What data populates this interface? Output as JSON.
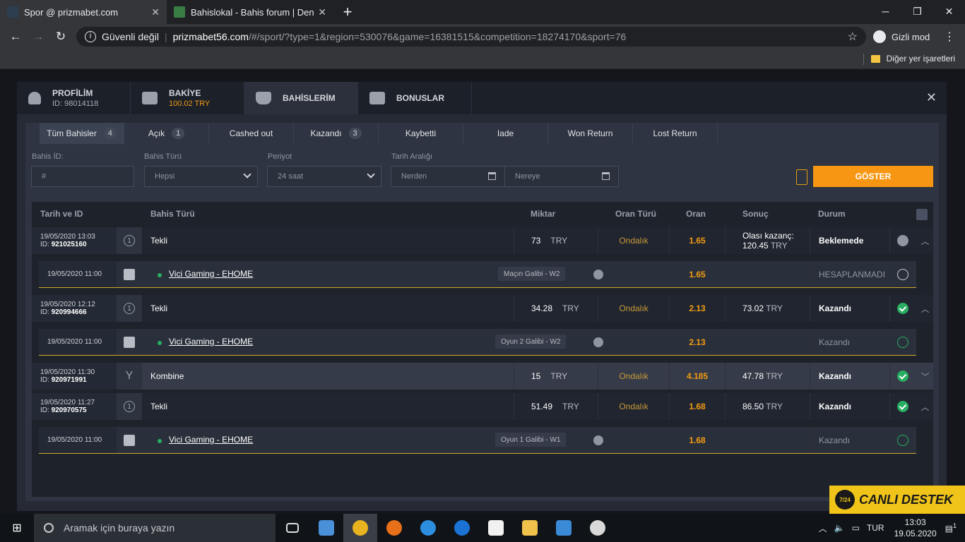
{
  "browser": {
    "tabs": [
      {
        "title": "Spor @ prizmabet.com",
        "active": true
      },
      {
        "title": "Bahislokal - Bahis forum | Denem",
        "active": false
      }
    ],
    "security": "Güvenli değil",
    "url_domain": "prizmabet56.com",
    "url_path": "/#/sport/?type=1&region=530076&game=16381515&competition=18274170&sport=76",
    "incognito": "Gizli mod",
    "bookmarks_other": "Diğer yer işaretleri"
  },
  "account_tabs": [
    {
      "title": "PROFİLİM",
      "sub": "ID: 98014118",
      "icon": "user-icon"
    },
    {
      "title": "BAKİYE",
      "sub": "100.02 TRY",
      "icon": "wallet-icon"
    },
    {
      "title": "BAHİSLERİM",
      "sub": "",
      "icon": "trophy-icon"
    },
    {
      "title": "BONUSLAR",
      "sub": "",
      "icon": "gift-icon"
    }
  ],
  "filter_tabs": [
    {
      "label": "Tüm Bahisler",
      "count": "4"
    },
    {
      "label": "Açık",
      "count": "1"
    },
    {
      "label": "Cashed out",
      "count": ""
    },
    {
      "label": "Kazandı",
      "count": "3"
    },
    {
      "label": "Kaybetti",
      "count": ""
    },
    {
      "label": "Iade",
      "count": ""
    },
    {
      "label": "Won Return",
      "count": ""
    },
    {
      "label": "Lost Return",
      "count": ""
    }
  ],
  "filters": {
    "bet_id_label": "Bahis İD:",
    "bet_id_placeholder": "#",
    "bet_type_label": "Bahis Türü",
    "bet_type_value": "Hepsi",
    "period_label": "Periyot",
    "period_value": "24 saat",
    "date_range_label": "Tarih Aralığı",
    "from_placeholder": "Nerden",
    "to_placeholder": "Nereye",
    "show_button": "GÖSTER"
  },
  "columns": {
    "date": "Tarih ve ID",
    "type": "Bahis Türü",
    "amount": "Miktar",
    "odds_type": "Oran Türü",
    "odds": "Oran",
    "result": "Sonuç",
    "status": "Durum"
  },
  "bets": [
    {
      "date": "19/05/2020 13:03",
      "id": "921025160",
      "type": "Tekli",
      "amount": "73",
      "currency": "TRY",
      "odds_type": "Ondalık",
      "odds": "1.65",
      "result_label": "Olası kazanç:",
      "result": "120.45",
      "status": "Beklemede",
      "event": {
        "date": "19/05/2020 11:00",
        "match": "Vici Gaming - EHOME",
        "market": "Maçın Galibi - W2",
        "odds": "1.65",
        "status": "HESAPLANMADI"
      }
    },
    {
      "date": "19/05/2020 12:12",
      "id": "920994666",
      "type": "Tekli",
      "amount": "34.28",
      "currency": "TRY",
      "odds_type": "Ondalık",
      "odds": "2.13",
      "result_label": "",
      "result": "73.02",
      "status": "Kazandı",
      "event": {
        "date": "19/05/2020 11:00",
        "match": "Vici Gaming - EHOME",
        "market": "Oyun 2 Galibi - W2",
        "odds": "2.13",
        "status": "Kazandı"
      }
    },
    {
      "date": "19/05/2020 11:30",
      "id": "920971991",
      "type": "Kombine",
      "amount": "15",
      "currency": "TRY",
      "odds_type": "Ondalık",
      "odds": "4.185",
      "result_label": "",
      "result": "47.78",
      "status": "Kazandı"
    },
    {
      "date": "19/05/2020 11:27",
      "id": "920970575",
      "type": "Tekli",
      "amount": "51.49",
      "currency": "TRY",
      "odds_type": "Ondalık",
      "odds": "1.68",
      "result_label": "",
      "result": "86.50",
      "status": "Kazandı",
      "event": {
        "date": "19/05/2020 11:00",
        "match": "Vici Gaming - EHOME",
        "market": "Oyun 1 Galibi - W1",
        "odds": "1.68",
        "status": "Kazandı"
      }
    }
  ],
  "support": "CANLI DESTEK",
  "support_badge": "7/24",
  "taskbar": {
    "search_placeholder": "Aramak için buraya yazın",
    "lang": "TUR",
    "time": "13:03",
    "date": "19.05.2020",
    "notif": "1"
  }
}
